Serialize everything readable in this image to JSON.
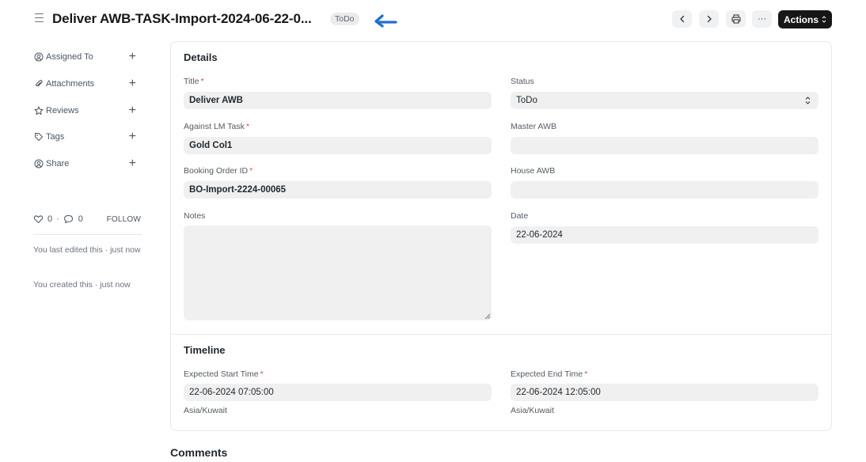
{
  "header": {
    "title": "Deliver AWB-TASK-Import-2024-06-22-0...",
    "status_badge": "ToDo",
    "actions_label": "Actions",
    "more_label": "···"
  },
  "sidebar": {
    "items": [
      {
        "label": "Assigned To",
        "icon": "assign-icon"
      },
      {
        "label": "Attachments",
        "icon": "paperclip-icon"
      },
      {
        "label": "Reviews",
        "icon": "star-icon"
      },
      {
        "label": "Tags",
        "icon": "tag-icon"
      },
      {
        "label": "Share",
        "icon": "share-icon"
      }
    ],
    "likes": "0",
    "comments": "0",
    "follow_label": "FOLLOW",
    "activity": [
      "You last edited this · just now",
      "You created this · just now"
    ]
  },
  "details": {
    "section_title": "Details",
    "title_label": "Title",
    "title_value": "Deliver AWB",
    "status_label": "Status",
    "status_value": "ToDo",
    "against_label": "Against LM Task",
    "against_value": "Gold Col1",
    "master_awb_label": "Master AWB",
    "master_awb_value": "",
    "booking_label": "Booking Order ID",
    "booking_value": "BO-Import-2224-00065",
    "house_awb_label": "House AWB",
    "house_awb_value": "",
    "notes_label": "Notes",
    "date_label": "Date",
    "date_value": "22-06-2024"
  },
  "timeline": {
    "section_title": "Timeline",
    "start_label": "Expected Start Time",
    "start_value": "22-06-2024 07:05:00",
    "start_tz": "Asia/Kuwait",
    "end_label": "Expected End Time",
    "end_value": "22-06-2024 12:05:00",
    "end_tz": "Asia/Kuwait"
  },
  "comments": {
    "title": "Comments"
  },
  "colors": {
    "accent_arrow": "#1a6fd6",
    "actions_bg": "#171717",
    "required": "#e24c4c",
    "field_bg": "#f0f0f0"
  }
}
